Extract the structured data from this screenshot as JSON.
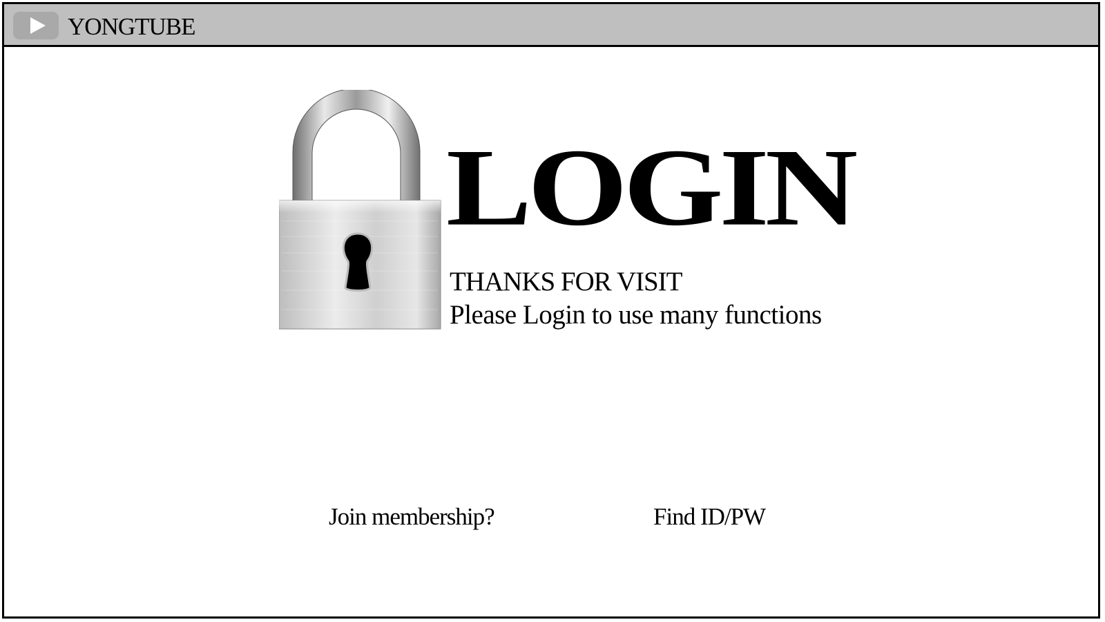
{
  "header": {
    "brand": "YONGTUBE",
    "logo_icon": "play-icon"
  },
  "main": {
    "title": "LOGIN",
    "subtitle": "THANKS FOR VISIT",
    "message": "Please Login to use many functions",
    "padlock_icon": "padlock-icon"
  },
  "links": {
    "join": "Join membership?",
    "find": "Find ID/PW"
  },
  "colors": {
    "topbar": "#bfbfbf",
    "border": "#000000",
    "background": "#ffffff"
  }
}
